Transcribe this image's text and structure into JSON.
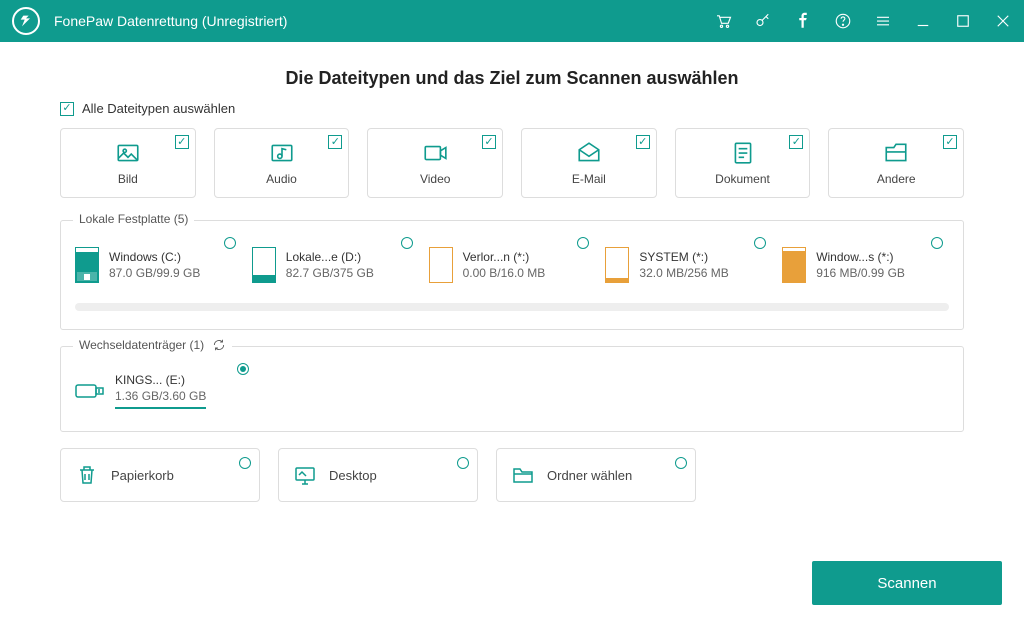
{
  "titlebar": {
    "app_name": "FonePaw Datenrettung (Unregistriert)"
  },
  "heading": "Die Dateitypen und das Ziel zum Scannen auswählen",
  "select_all_label": "Alle Dateitypen auswählen",
  "types": {
    "image": "Bild",
    "audio": "Audio",
    "video": "Video",
    "email": "E-Mail",
    "document": "Dokument",
    "other": "Andere"
  },
  "sections": {
    "local": "Lokale Festplatte (5)",
    "removable": "Wechseldatenträger (1)"
  },
  "drives": {
    "local": [
      {
        "name": "Windows (C:)",
        "size": "87.0 GB/99.9 GB",
        "color": "teal",
        "fill": 87,
        "win": true
      },
      {
        "name": "Lokale...e (D:)",
        "size": "82.7 GB/375 GB",
        "color": "teal",
        "fill": 22,
        "win": false
      },
      {
        "name": "Verlor...n (*:)",
        "size": "0.00  B/16.0 MB",
        "color": "orange",
        "fill": 0,
        "win": false
      },
      {
        "name": "SYSTEM (*:)",
        "size": "32.0 MB/256 MB",
        "color": "orange",
        "fill": 13,
        "win": false
      },
      {
        "name": "Window...s (*:)",
        "size": "916 MB/0.99 GB",
        "color": "orange",
        "fill": 92,
        "win": false
      }
    ],
    "removable": [
      {
        "name": "KINGS... (E:)",
        "size": "1.36 GB/3.60 GB",
        "selected": true
      }
    ]
  },
  "locations": {
    "recycle": "Papierkorb",
    "desktop": "Desktop",
    "folder": "Ordner wählen"
  },
  "scan_button": "Scannen"
}
